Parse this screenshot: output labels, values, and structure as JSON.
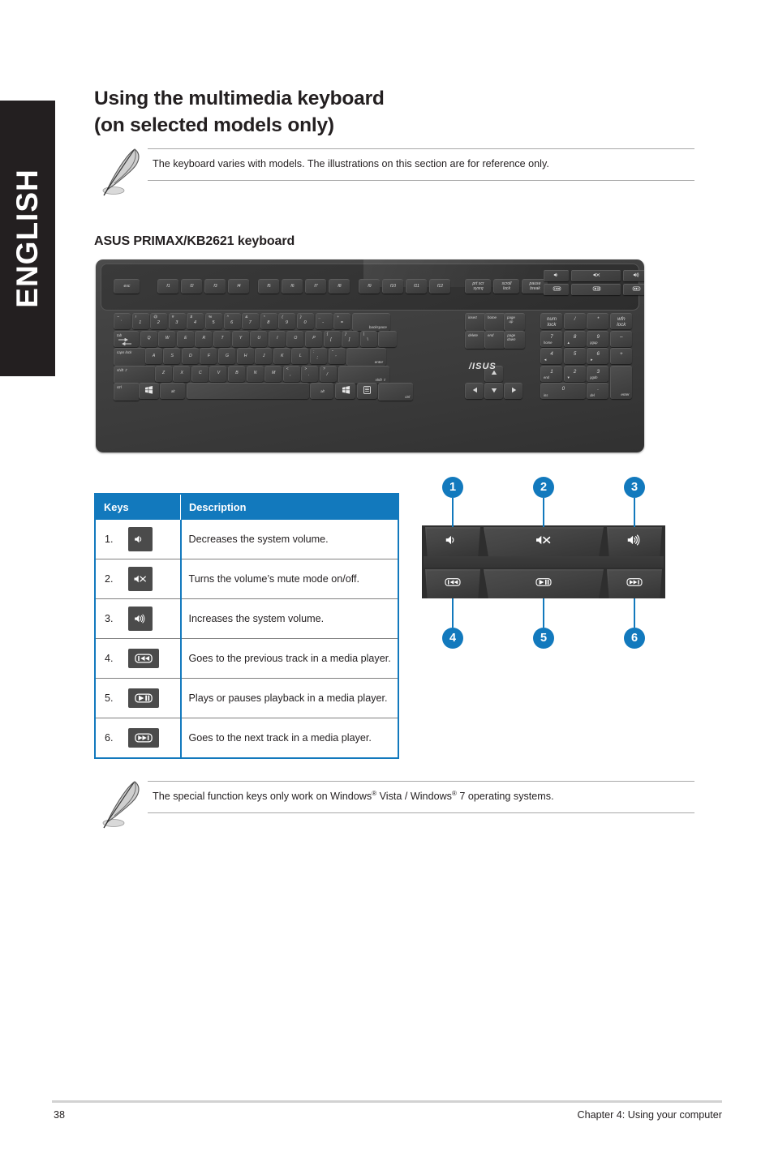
{
  "language_tab": {
    "label": "ENGLISH"
  },
  "heading": {
    "line1": "Using the multimedia keyboard",
    "line2": "(on selected models only)"
  },
  "note_top": {
    "icon": "note-pencil-icon",
    "text": "The keyboard varies with models. The illustrations on this section are for reference only."
  },
  "sub_heading": {
    "label": "ASUS PRIMAX/KB2621 keyboard"
  },
  "keyboard_figure": {
    "brand_logo": "/ISUS",
    "function_row": [
      "esc",
      "f1",
      "f2",
      "f3",
      "f4",
      "f5",
      "f6",
      "f7",
      "f8",
      "f9",
      "f10",
      "f11",
      "f12"
    ],
    "system_keys": [
      "prt scr\nsysrq",
      "scroll\nlock",
      "pause\nbreak"
    ],
    "media_row_top": [
      "volume-down-icon",
      "mute-icon",
      "volume-up-icon"
    ],
    "media_row_bottom": [
      "prev-track-icon",
      "play-pause-icon",
      "next-track-icon"
    ],
    "number_row": [
      {
        "up": "~",
        "lo": "`"
      },
      {
        "up": "!",
        "lo": "1"
      },
      {
        "up": "@",
        "lo": "2"
      },
      {
        "up": "#",
        "lo": "3"
      },
      {
        "up": "$",
        "lo": "4"
      },
      {
        "up": "%",
        "lo": "5"
      },
      {
        "up": "^",
        "lo": "6"
      },
      {
        "up": "&",
        "lo": "7"
      },
      {
        "up": "*",
        "lo": "8"
      },
      {
        "up": "(",
        "lo": "9"
      },
      {
        "up": ")",
        "lo": "0"
      },
      {
        "up": "_",
        "lo": "-"
      },
      {
        "up": "+",
        "lo": "="
      }
    ],
    "backspace": "backspace",
    "row_q": [
      "tab",
      "Q",
      "W",
      "E",
      "R",
      "T",
      "Y",
      "U",
      "I",
      "O",
      "P"
    ],
    "row_q_tail": [
      {
        "up": "{",
        "lo": "["
      },
      {
        "up": "}",
        "lo": "]"
      },
      {
        "up": "|",
        "lo": "\\"
      }
    ],
    "row_a": [
      "caps lock",
      "A",
      "S",
      "D",
      "F",
      "G",
      "H",
      "J",
      "K",
      "L"
    ],
    "row_a_tail": [
      {
        "up": ":",
        "lo": ";"
      },
      {
        "up": "\"",
        "lo": "'"
      }
    ],
    "enter": "enter",
    "row_z": [
      "shift",
      "Z",
      "X",
      "C",
      "V",
      "B",
      "N",
      "M"
    ],
    "row_z_tail": [
      {
        "up": "<",
        "lo": ","
      },
      {
        "up": ">",
        "lo": "."
      },
      {
        "up": "?",
        "lo": "/"
      }
    ],
    "right_shift": "shift",
    "bottom_row": [
      "ctrl",
      "win-icon",
      "alt",
      "space",
      "alt",
      "win-icon",
      "menu-icon",
      "ctrl"
    ],
    "nav_cluster": [
      "insert",
      "home",
      "page\nup",
      "delete",
      "end",
      "page\ndown"
    ],
    "arrows": [
      "arrow-up-icon",
      "arrow-left-icon",
      "arrow-down-icon",
      "arrow-right-icon"
    ],
    "numpad": [
      {
        "big": "num\nlock",
        "sm": ""
      },
      {
        "big": "/",
        "sm": ""
      },
      {
        "big": "*",
        "sm": ""
      },
      {
        "big": "wfn\nlock",
        "sm": ""
      },
      {
        "big": "7",
        "sm": "home"
      },
      {
        "big": "8",
        "sm": "▲"
      },
      {
        "big": "9",
        "sm": "pgup"
      },
      {
        "big": "–",
        "sm": ""
      },
      {
        "big": "4",
        "sm": "◄"
      },
      {
        "big": "5",
        "sm": ""
      },
      {
        "big": "6",
        "sm": "►"
      },
      {
        "big": "+",
        "sm": ""
      },
      {
        "big": "1",
        "sm": "end"
      },
      {
        "big": "2",
        "sm": "▼"
      },
      {
        "big": "3",
        "sm": "pgdn"
      },
      {
        "big": "enter",
        "sm": ""
      },
      {
        "big": "0",
        "sm": "ins"
      },
      {
        "big": ".",
        "sm": "del"
      }
    ]
  },
  "keys_table": {
    "columns": [
      "Keys",
      "Description"
    ],
    "rows": [
      {
        "num": "1.",
        "icon": "volume-down-icon",
        "description": "Decreases the system volume."
      },
      {
        "num": "2.",
        "icon": "mute-icon",
        "description": "Turns the volume’s mute mode on/off."
      },
      {
        "num": "3.",
        "icon": "volume-up-icon",
        "description": "Increases the system volume."
      },
      {
        "num": "4.",
        "icon": "prev-track-icon",
        "description": "Goes to the previous track in a media player."
      },
      {
        "num": "5.",
        "icon": "play-pause-icon",
        "description": "Plays or pauses playback in a media player."
      },
      {
        "num": "6.",
        "icon": "next-track-icon",
        "description": "Goes to the next track in a media player."
      }
    ]
  },
  "callout": {
    "accent_color": "#1279bd",
    "top_numbers": [
      "1",
      "2",
      "3"
    ],
    "bottom_numbers": [
      "4",
      "5",
      "6"
    ],
    "top_keys": [
      "volume-down-icon",
      "mute-icon",
      "volume-up-icon"
    ],
    "bottom_keys": [
      "prev-track-icon",
      "play-pause-icon",
      "next-track-icon"
    ]
  },
  "note_bottom": {
    "icon": "note-pencil-icon",
    "text_part1": "The special function keys only work on Windows",
    "sup1": "®",
    "text_part2": " Vista / Windows",
    "sup2": "®",
    "text_part3": " 7 operating systems."
  },
  "footer": {
    "page_number": "38",
    "chapter": "Chapter 4: Using your computer"
  }
}
